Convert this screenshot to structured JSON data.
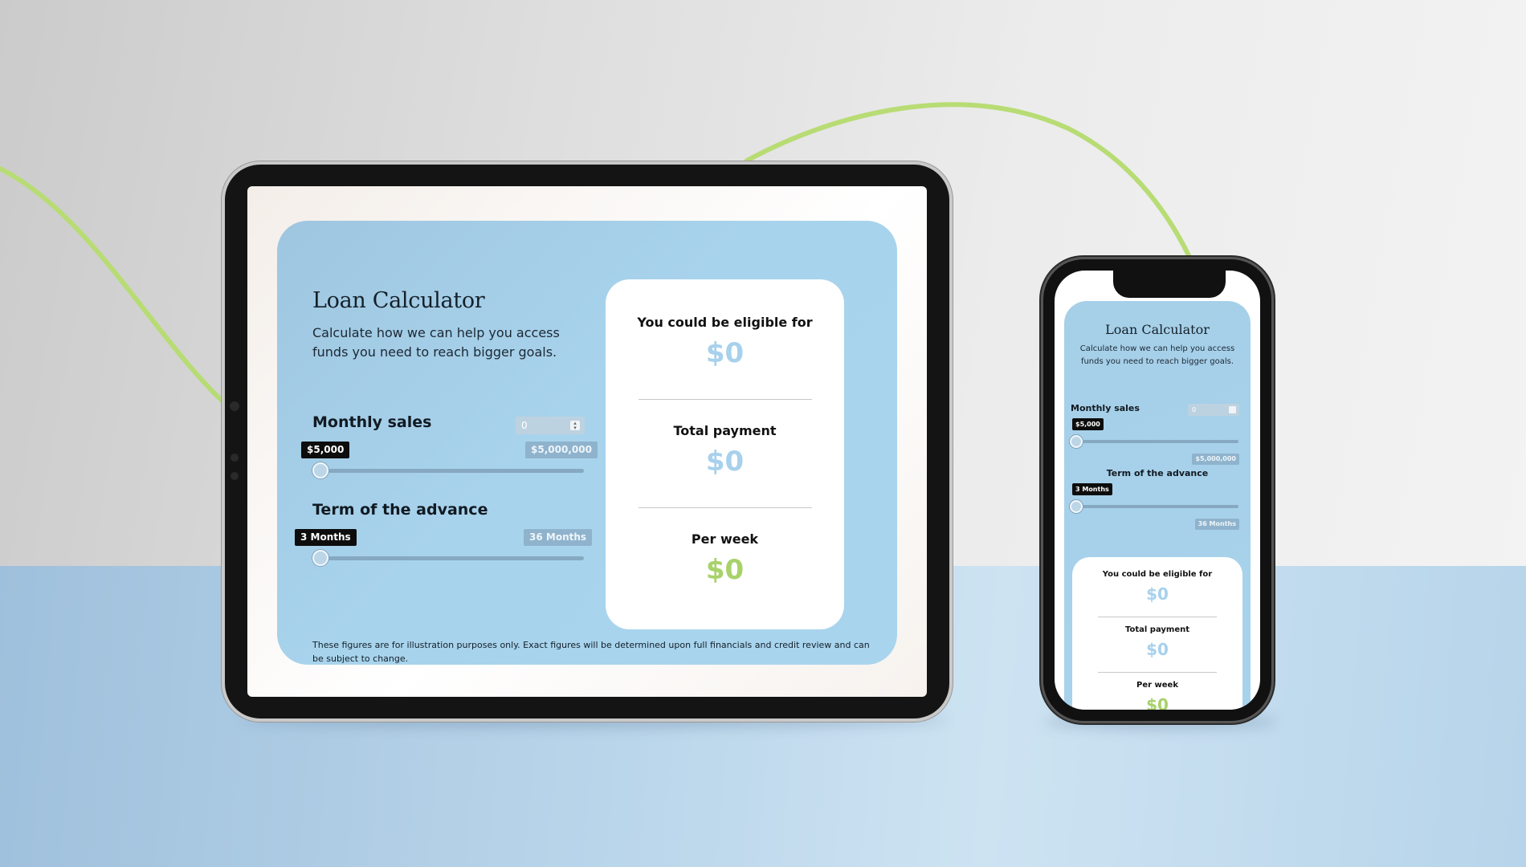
{
  "colors": {
    "card_bg": "#a8d3ec",
    "result_blue": "#a7d1ec",
    "result_green": "#a8d26a",
    "curve_green": "#b8dc74",
    "tag_dark": "#0d0d0d"
  },
  "calculator": {
    "title": "Loan Calculator",
    "subtitle": "Calculate how we can help you access funds you need to reach bigger goals.",
    "monthly_sales": {
      "label": "Monthly sales",
      "input_value": "0",
      "min_label": "$5,000",
      "max_label": "$5,000,000",
      "slider_fraction": 0
    },
    "term": {
      "label": "Term of the advance",
      "min_label": "3 Months",
      "max_label": "36 Months",
      "slider_fraction": 0
    },
    "results": {
      "eligible_label": "You could be eligible for",
      "eligible_value": "$0",
      "total_label": "Total payment",
      "total_value": "$0",
      "week_label": "Per week",
      "week_value": "$0"
    },
    "disclaimer": "These figures are for illustration purposes only. Exact figures will be determined upon full financials and credit review and can be subject to change."
  }
}
